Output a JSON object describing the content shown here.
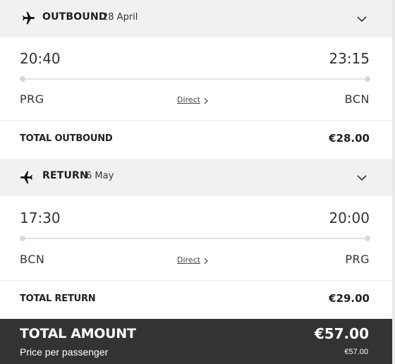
{
  "outbound": {
    "title": "OUTBOUND",
    "date": "28 April",
    "depart_time": "20:40",
    "arrive_time": "23:15",
    "origin": "PRG",
    "destination": "BCN",
    "direct_label": "Direct",
    "total_label": "TOTAL OUTBOUND",
    "total_value": "€28.00"
  },
  "return": {
    "title": "RETURN",
    "date": "6 May",
    "depart_time": "17:30",
    "arrive_time": "20:00",
    "origin": "BCN",
    "destination": "PRG",
    "direct_label": "Direct",
    "total_label": "TOTAL RETURN",
    "total_value": "€29.00"
  },
  "summary": {
    "total_label": "TOTAL AMOUNT",
    "total_value": "€57.00",
    "per_passenger_label": "Price per passenger",
    "per_passenger_value": "€57.00"
  },
  "colors": {
    "header_bg": "#f1f1f1",
    "footer_bg": "#333333",
    "text": "#2b2b2b"
  },
  "icons": {
    "outbound": "plane-takeoff-icon",
    "return": "plane-landing-icon",
    "expand": "chevron-down-icon",
    "direct": "chevron-right-icon"
  }
}
